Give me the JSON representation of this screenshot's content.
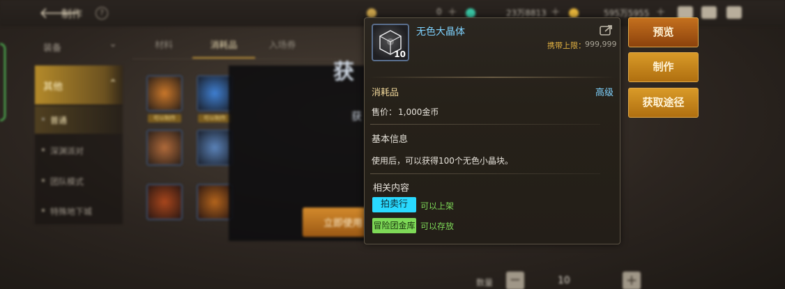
{
  "header": {
    "title": "制作",
    "currencies": [
      {
        "name": "moon-currency",
        "value": "0",
        "color": "#c9a24a"
      },
      {
        "name": "crystal-currency",
        "value": "23万8813",
        "color": "#39c7a5"
      },
      {
        "name": "gold-currency",
        "value": "595万5955",
        "color": "#e6b53a"
      }
    ]
  },
  "sidebar": {
    "category": "装备",
    "group": "其他",
    "items": [
      "普通",
      "深渊派对",
      "团队模式",
      "特殊地下城"
    ]
  },
  "tabs": [
    "材料",
    "消耗品",
    "入场券"
  ],
  "slots": [
    {
      "color": "#c9772a",
      "badge": "可以制作"
    },
    {
      "color": "#3f7fd1",
      "badge": "可以制作"
    },
    {
      "color": "#b06a3a",
      "badge": ""
    },
    {
      "color": "#5a82b8",
      "badge": ""
    },
    {
      "color": "#a8461c",
      "badge": ""
    },
    {
      "color": "#b3641c",
      "badge": ""
    }
  ],
  "modal": {
    "title": "获",
    "subtitle": "获",
    "use_button": "立即使用"
  },
  "quantity": {
    "label": "数量",
    "value": "10"
  },
  "tooltip": {
    "name": "无色大晶体",
    "count": "10",
    "limit_label": "携带上限：",
    "limit_value": "999,999",
    "type": "消耗品",
    "grade": "高级",
    "price_label": "售价：",
    "price_value": "1,000金币",
    "basic_info_title": "基本信息",
    "description": "使用后，可以获得100个无色小晶块。",
    "related_title": "相关内容",
    "auction_tag": "拍卖行",
    "auction_note": "可以上架",
    "bank_tag": "冒险团金库",
    "bank_note": "可以存放"
  },
  "actions": {
    "preview": "预览",
    "make": "制作",
    "source": "获取途径"
  }
}
